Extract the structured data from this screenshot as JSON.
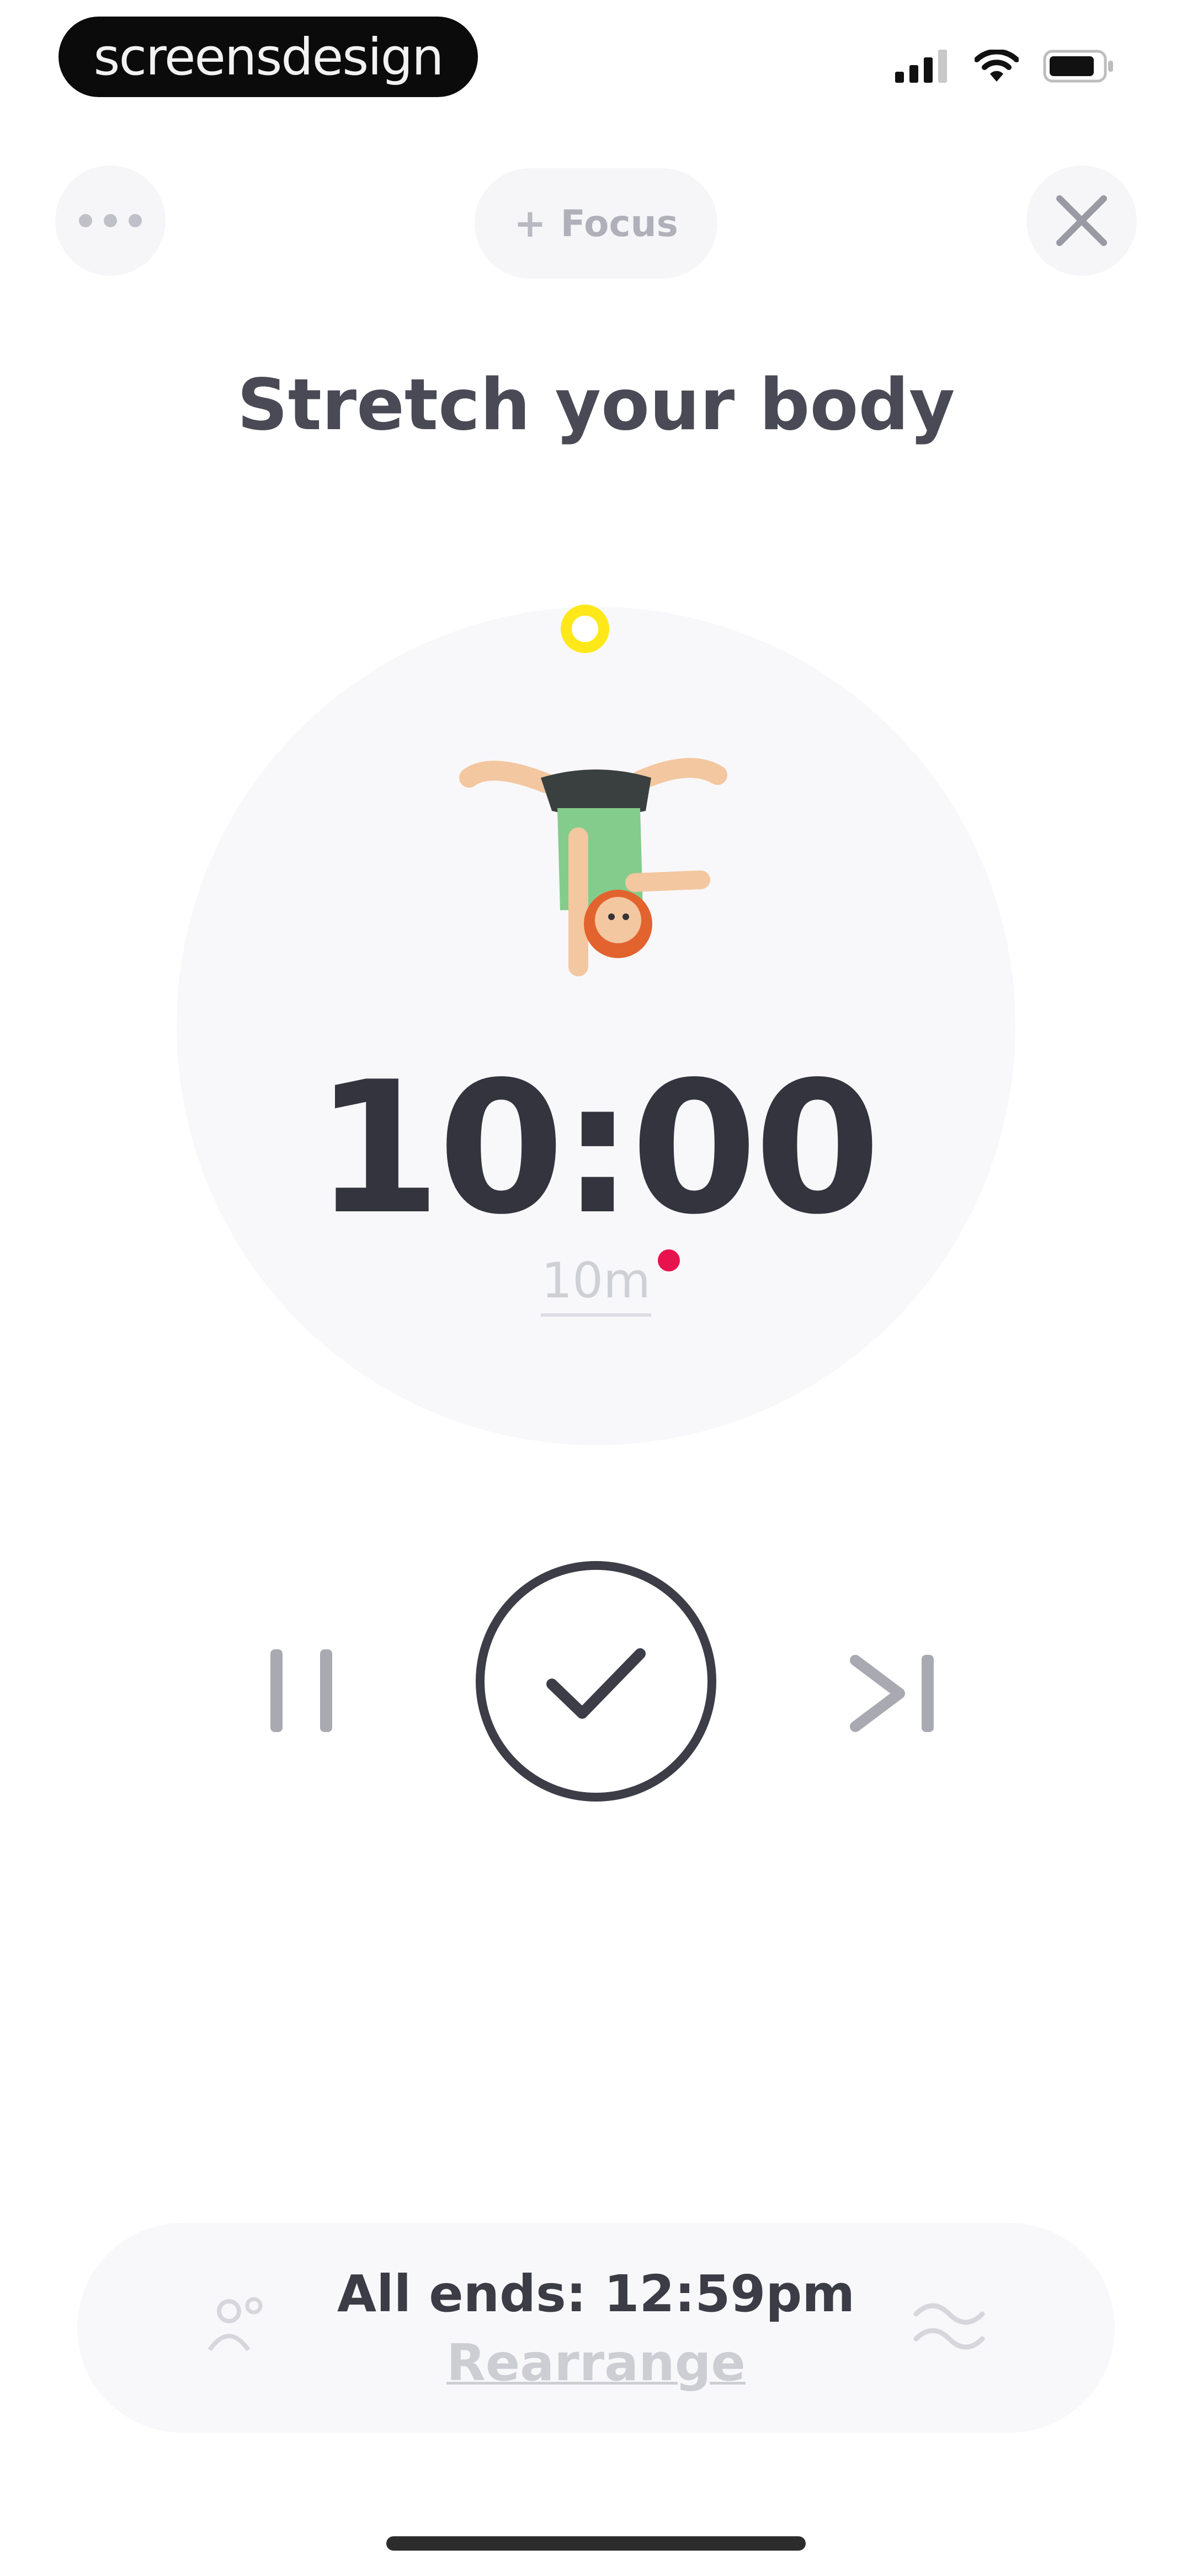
{
  "status_bar": {
    "brand_watermark": "screensdesign",
    "signal_icon": "cellular-signal-icon",
    "wifi_icon": "wifi-icon",
    "battery_icon": "battery-icon"
  },
  "header": {
    "more_icon": "ellipsis-icon",
    "focus_label": "Focus",
    "focus_icon": "plus-icon",
    "close_icon": "close-icon"
  },
  "task": {
    "title": "Stretch your body",
    "timer": "10:00",
    "duration": "10m",
    "illustration": "person-handstand-illustration"
  },
  "controls": {
    "pause_icon": "pause-icon",
    "done_icon": "checkmark-icon",
    "skip_icon": "skip-forward-icon"
  },
  "footer": {
    "ends_text": "All ends: 12:59pm",
    "rearrange_label": "Rearrange",
    "left_icon": "people-icon",
    "right_icon": "wave-icon"
  },
  "colors": {
    "accent_yellow": "#ffe81a",
    "dot_red": "#e8134e",
    "text_dark": "#34343e",
    "surface": "#f8f8fb"
  }
}
